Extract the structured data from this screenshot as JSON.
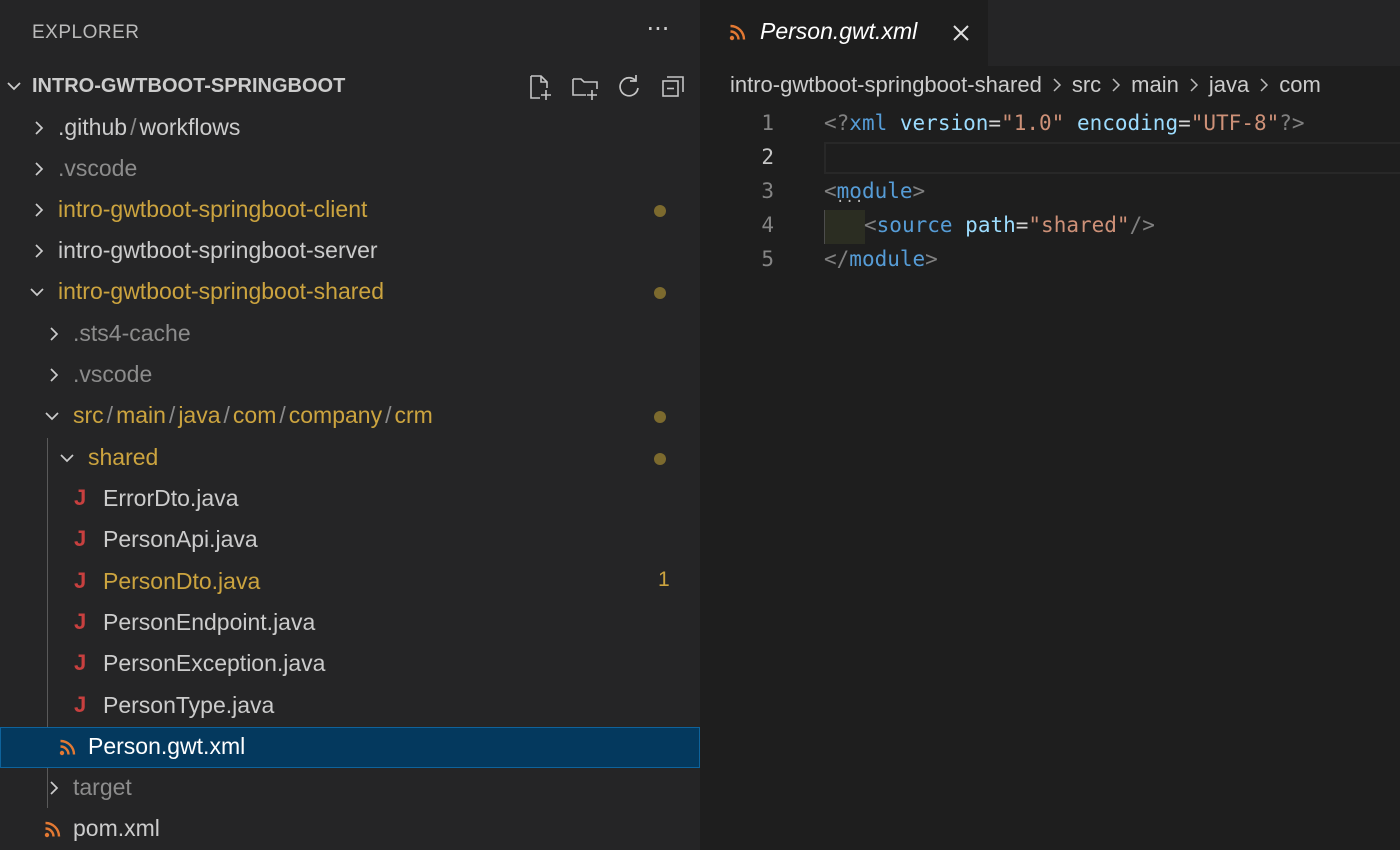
{
  "explorer": {
    "title": "EXPLORER",
    "more_label": "···",
    "section_title": "INTRO-GWTBOOT-SPRINGBOOT",
    "actions": [
      "new-file-icon",
      "new-folder-icon",
      "refresh-icon",
      "collapse-all-icon"
    ]
  },
  "tree": {
    "github": {
      "a": ".github",
      "b": "workflows"
    },
    "vscode_root": ".vscode",
    "client": "intro-gwtboot-springboot-client",
    "server": "intro-gwtboot-springboot-server",
    "shared_module": "intro-gwtboot-springboot-shared",
    "sts4": ".sts4-cache",
    "vscode_shared": ".vscode",
    "src_path": [
      "src",
      "main",
      "java",
      "com",
      "company",
      "crm"
    ],
    "shared_pkg": "shared",
    "files": {
      "error": "ErrorDto.java",
      "api": "PersonApi.java",
      "dto": "PersonDto.java",
      "endpoint": "PersonEndpoint.java",
      "exception": "PersonException.java",
      "type": "PersonType.java"
    },
    "dto_badge": "1",
    "java_icon_glyph": "J",
    "gwt_xml": "Person.gwt.xml",
    "target": "target",
    "pom": "pom.xml"
  },
  "editor": {
    "tab_label": "Person.gwt.xml",
    "breadcrumbs": [
      "intro-gwtboot-springboot-shared",
      "src",
      "main",
      "java",
      "com"
    ],
    "line_numbers": [
      "1",
      "2",
      "3",
      "4",
      "5"
    ],
    "fold_dots": "···",
    "code": {
      "l1": {
        "open": "<?",
        "tag": "xml",
        "attr1": "version",
        "eq": "=",
        "val1": "\"1.0\"",
        "attr2": "encoding",
        "val2": "\"UTF-8\"",
        "close": "?>"
      },
      "l3": {
        "open": "<",
        "tag": "module",
        "close": ">"
      },
      "l4": {
        "open": "<",
        "tag": "source",
        "attr": "path",
        "eq": "=",
        "val": "\"shared\"",
        "close": "/>"
      },
      "l5": {
        "open": "</",
        "tag": "module",
        "close": ">"
      }
    }
  },
  "colors": {
    "modified": "#cca43f",
    "java_icon": "#c8403f",
    "xml_icon": "#e37933",
    "selection": "#04395e"
  }
}
